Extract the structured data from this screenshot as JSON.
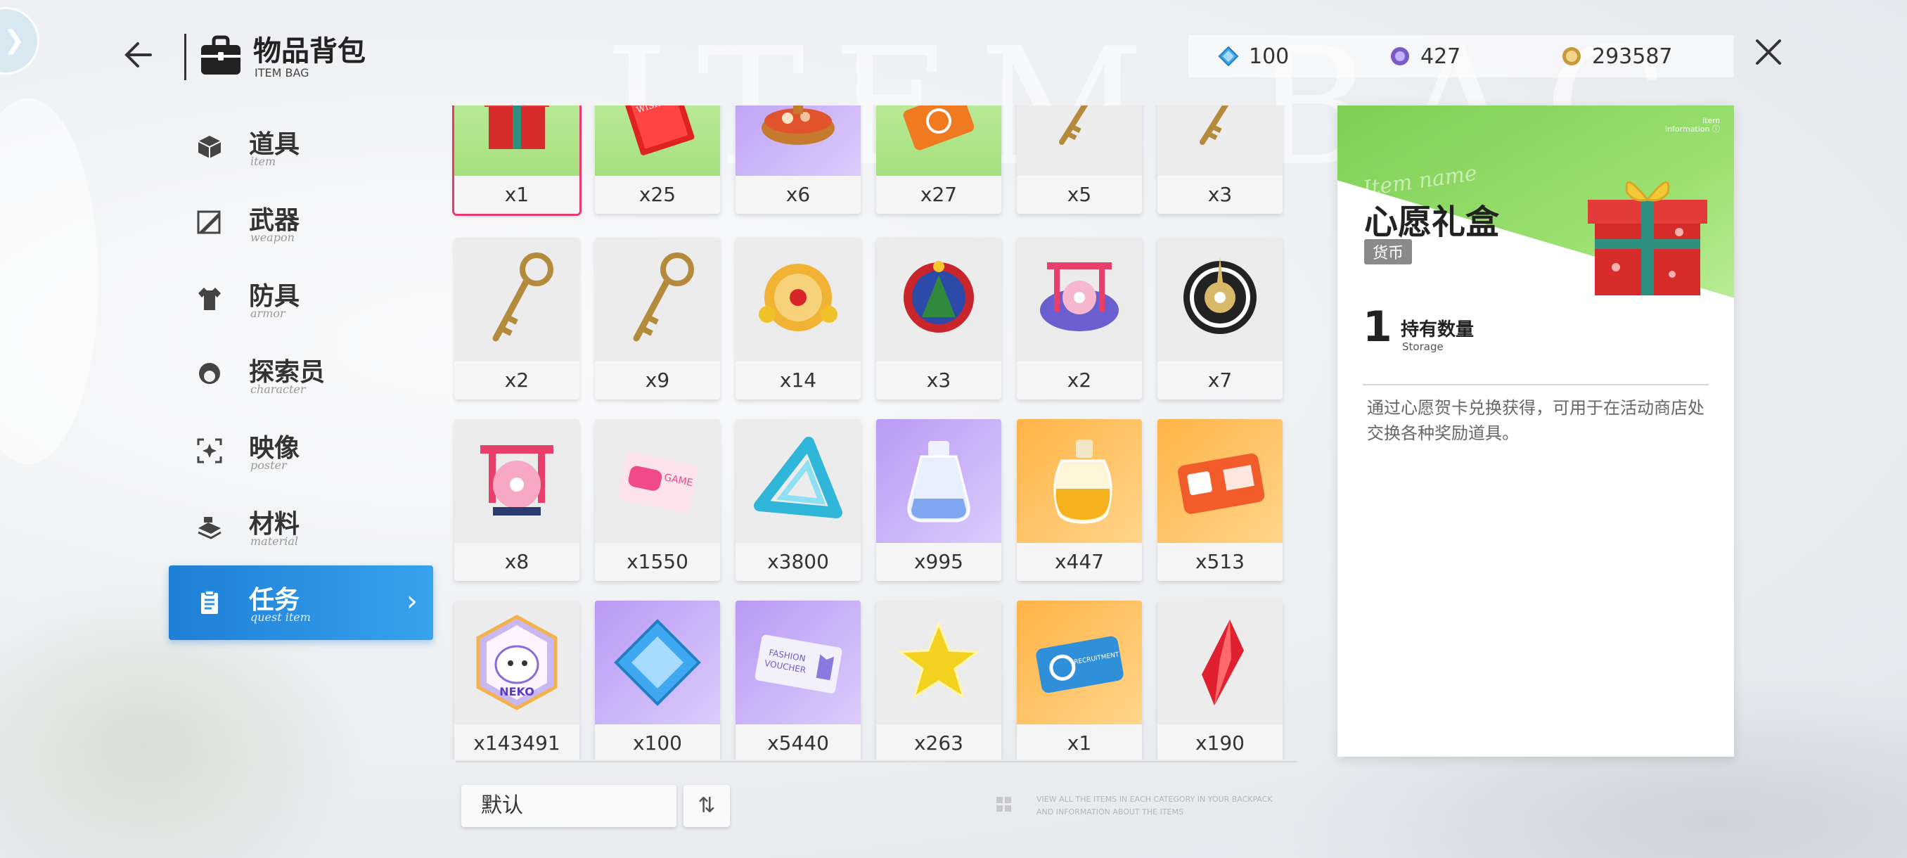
{
  "header": {
    "title": "物品背包",
    "subtitle": "ITEM BAG",
    "watermark": "ITEM BAG"
  },
  "currencies": [
    {
      "name": "diamond",
      "value": "100",
      "color": "#3fa8f0"
    },
    {
      "name": "purple-gem",
      "value": "427",
      "color": "#7a5cc9"
    },
    {
      "name": "gold-coin",
      "value": "293587",
      "color": "#c99a3d"
    }
  ],
  "sidebar": {
    "items": [
      {
        "label": "道具",
        "sub": "item",
        "icon": "box-icon"
      },
      {
        "label": "武器",
        "sub": "weapon",
        "icon": "sword-icon"
      },
      {
        "label": "防具",
        "sub": "armor",
        "icon": "shirt-icon"
      },
      {
        "label": "探索员",
        "sub": "character",
        "icon": "character-icon"
      },
      {
        "label": "映像",
        "sub": "poster",
        "icon": "poster-icon"
      },
      {
        "label": "材料",
        "sub": "material",
        "icon": "material-icon"
      },
      {
        "label": "任务",
        "sub": "quest item",
        "icon": "quest-icon",
        "active": true
      }
    ]
  },
  "grid": {
    "items": [
      {
        "qty": "x1",
        "icon": "gift-box-icon",
        "bg": "green",
        "selected": true
      },
      {
        "qty": "x25",
        "icon": "wish-card-icon",
        "bg": "green"
      },
      {
        "qty": "x6",
        "icon": "hotpot-icon",
        "bg": "purple"
      },
      {
        "qty": "x27",
        "icon": "ticket-icon",
        "bg": "green"
      },
      {
        "qty": "x5",
        "icon": "key-icon",
        "bg": "gray"
      },
      {
        "qty": "x3",
        "icon": "key-icon",
        "bg": "gray"
      },
      {
        "qty": "x2",
        "icon": "key-icon",
        "bg": "gray"
      },
      {
        "qty": "x9",
        "icon": "key-icon",
        "bg": "gray"
      },
      {
        "qty": "x14",
        "icon": "lantern-wreath-icon",
        "bg": "gray"
      },
      {
        "qty": "x3",
        "icon": "christmas-wreath-icon",
        "bg": "gray"
      },
      {
        "qty": "x2",
        "icon": "sakura-badge-icon",
        "bg": "gray"
      },
      {
        "qty": "x7",
        "icon": "compass-icon",
        "bg": "gray"
      },
      {
        "qty": "x8",
        "icon": "sakura-gate-icon",
        "bg": "gray"
      },
      {
        "qty": "x1550",
        "icon": "game-card-icon",
        "bg": "gray"
      },
      {
        "qty": "x3800",
        "icon": "triangle-icon",
        "bg": "gray"
      },
      {
        "qty": "x995",
        "icon": "blue-bottle-icon",
        "bg": "purple"
      },
      {
        "qty": "x447",
        "icon": "gold-bottle-icon",
        "bg": "orange"
      },
      {
        "qty": "x513",
        "icon": "gift-card-icon",
        "bg": "orange"
      },
      {
        "qty": "x143491",
        "icon": "neko-coin-icon",
        "bg": "gray"
      },
      {
        "qty": "x100",
        "icon": "diamond-icon",
        "bg": "purple"
      },
      {
        "qty": "x5440",
        "icon": "fashion-voucher-icon",
        "bg": "purple"
      },
      {
        "qty": "x263",
        "icon": "star-icon",
        "bg": "gray"
      },
      {
        "qty": "x1",
        "icon": "recruitment-ticket-icon",
        "bg": "orange"
      },
      {
        "qty": "x190",
        "icon": "red-crystal-icon",
        "bg": "gray"
      }
    ]
  },
  "card_text": {
    "wish": "WISHES",
    "game": "GAME",
    "neko": "NEKO",
    "fashion_line1": "FASHION",
    "fashion_line2": "VOUCHER",
    "recruit": "RECRUITMENT"
  },
  "bottom": {
    "sort_label": "默认",
    "sort_toggle": "⇅",
    "hint": "VIEW ALL THE ITEMS IN EACH CATEGORY IN YOUR BACKPACK AND INFORMATION ABOUT THE ITEMS"
  },
  "detail": {
    "info_tag_line1": "item",
    "info_tag_line2": "information ⓘ",
    "name_script": "Item name",
    "name": "心愿礼盒",
    "badge": "货币",
    "count": "1",
    "count_label": "持有数量",
    "count_sub": "Storage",
    "description": "通过心愿贺卡兑换获得，可用于在活动商店处交换各种奖励道具。"
  }
}
